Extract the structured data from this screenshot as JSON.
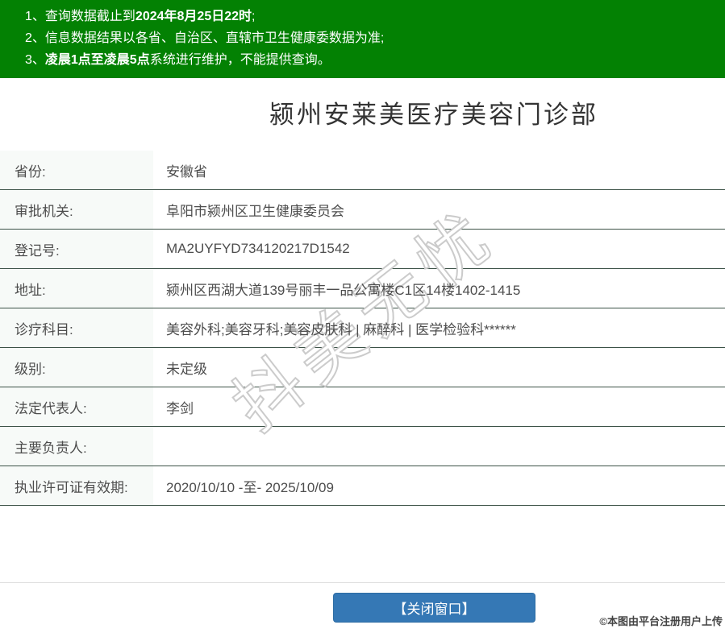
{
  "notice": {
    "items": [
      {
        "num": "1、",
        "pre": "查询数据截止到",
        "bold": "2024年8月25日22时",
        "post": ";"
      },
      {
        "num": "2、",
        "pre": "信息数据结果以各省、自治区、直辖市卫生健康委数据为准;",
        "bold": "",
        "post": ""
      },
      {
        "num": "3、",
        "pre": "",
        "bold": "凌晨1点至凌晨5点",
        "post": "系统进行维护，不能提供查询。"
      }
    ]
  },
  "title": "颍州安莱美医疗美容门诊部",
  "info_table": {
    "rows": [
      {
        "label": "省份:",
        "value": "安徽省"
      },
      {
        "label": "审批机关:",
        "value": "阜阳市颍州区卫生健康委员会"
      },
      {
        "label": "登记号:",
        "value": "MA2UYFYD734120217D1542"
      },
      {
        "label": "地址:",
        "value": "颍州区西湖大道139号丽丰一品公寓楼C1区14楼1402-1415"
      },
      {
        "label": "诊疗科目:",
        "value": "美容外科;美容牙科;美容皮肤科 | 麻醉科 | 医学检验科******"
      },
      {
        "label": "级别:",
        "value": "未定级"
      },
      {
        "label": "法定代表人:",
        "value": "李剑"
      },
      {
        "label": "主要负责人:",
        "value": ""
      },
      {
        "label": "执业许可证有效期:",
        "value": "2020/10/10 -至- 2025/10/09"
      }
    ]
  },
  "watermark": "抖美无忧",
  "footer": {
    "close_button_label": "【关闭窗口】",
    "copyright": "©本图由平台注册用户上传"
  },
  "colors": {
    "header_green": "#038103",
    "button_blue": "#3578b5",
    "row_divider": "#3c5247",
    "label_bg": "#f7faf8"
  }
}
